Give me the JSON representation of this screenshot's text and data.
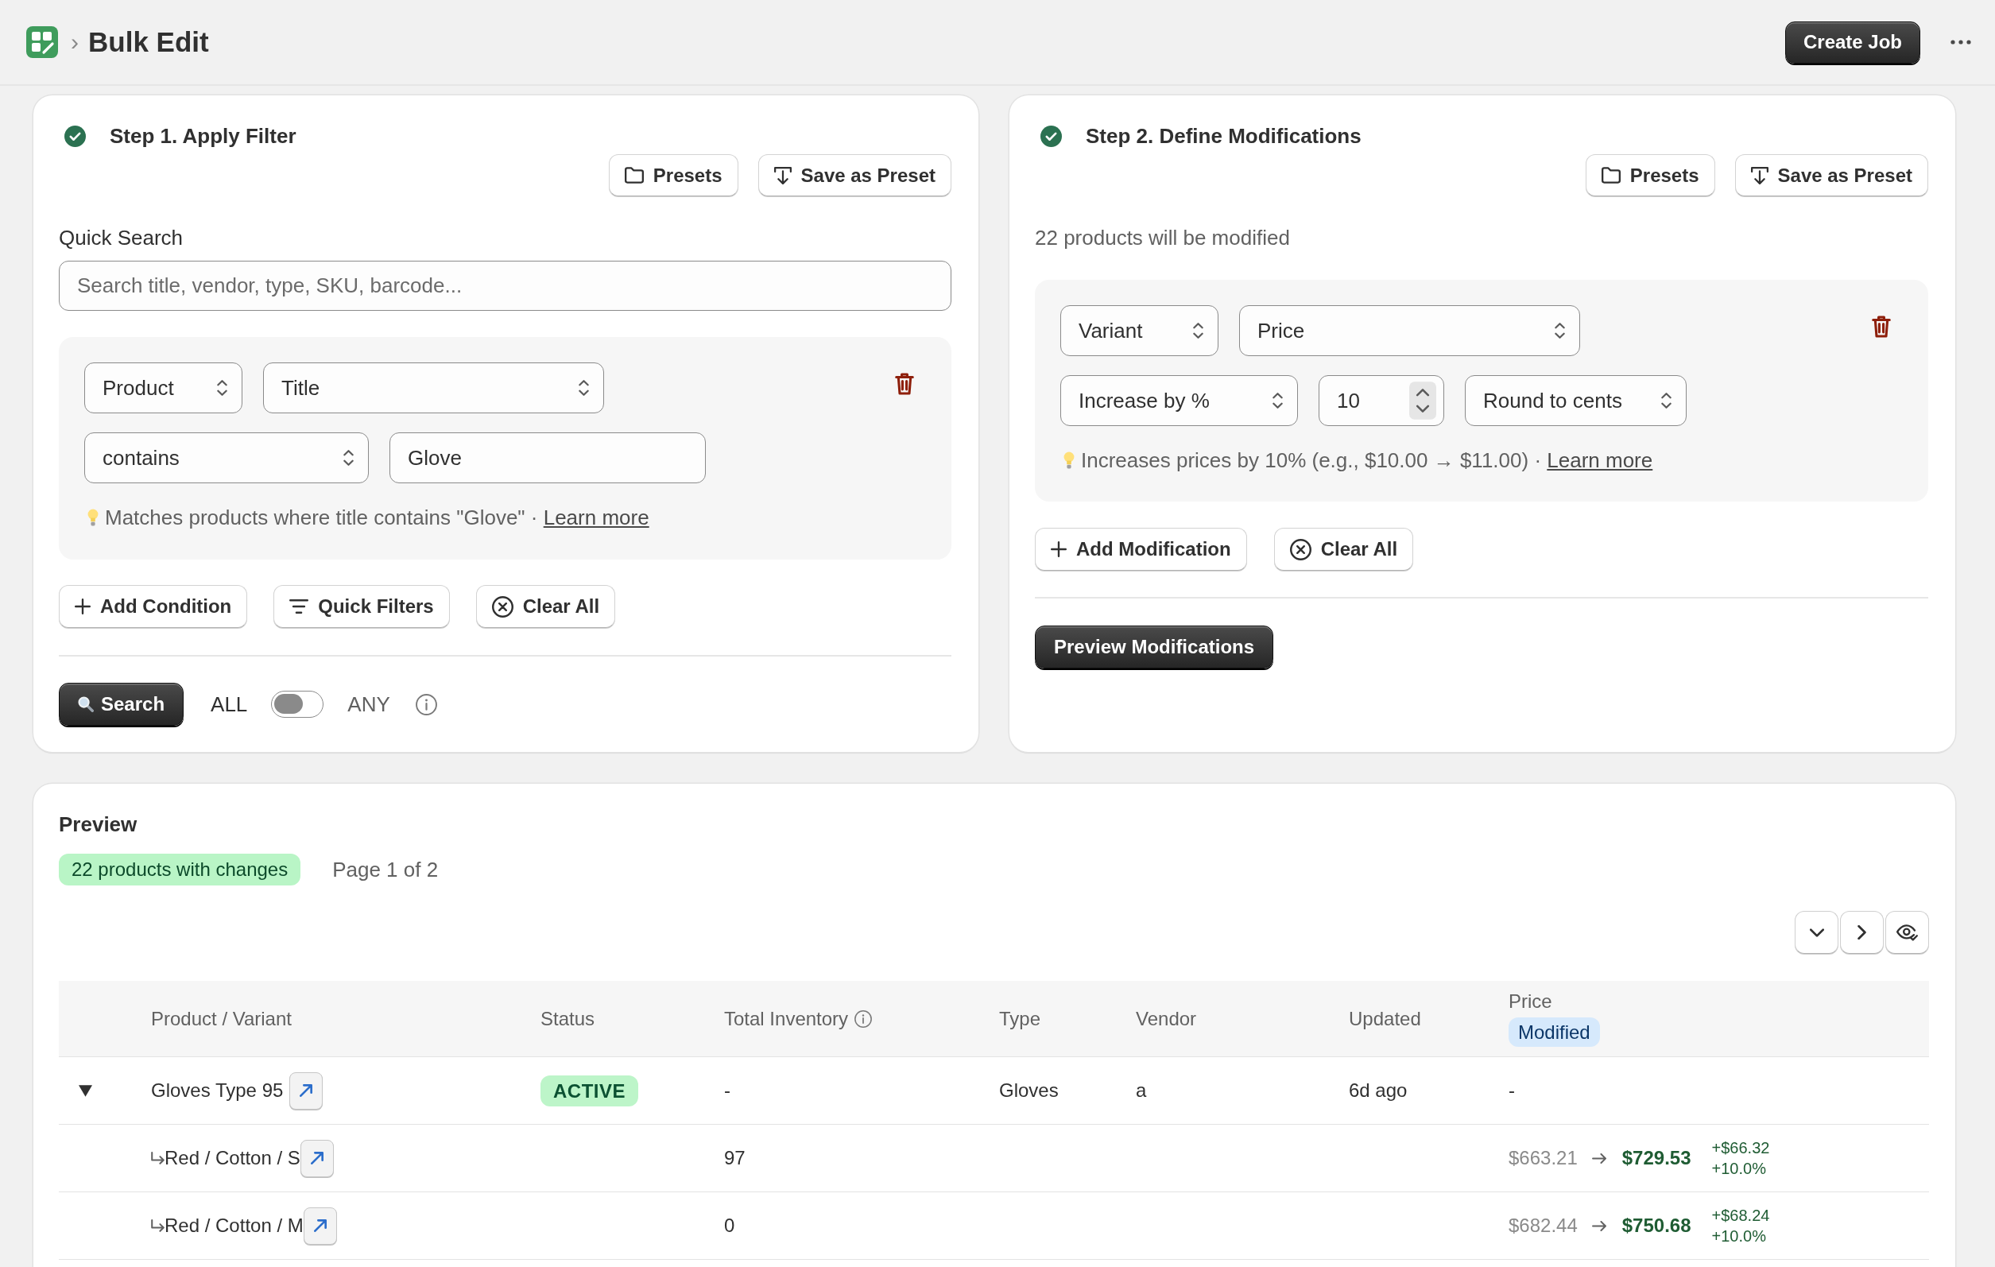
{
  "header": {
    "separator": "›",
    "title": "Bulk Edit",
    "create_job_button": "Create Job"
  },
  "filter_card": {
    "step_title": "Step 1. Apply Filter",
    "completed": true,
    "presets_button": "Presets",
    "save_preset_button": "Save as Preset",
    "quick_search": {
      "label": "Quick Search",
      "placeholder": "Search title, vendor, type, SKU, barcode..."
    },
    "conditions": [
      {
        "scope": "Product",
        "field": "Title",
        "operator": "contains",
        "value": "Glove",
        "hint": "Matches products where title contains \"Glove\" ·",
        "link": "Learn more"
      }
    ],
    "add_condition_button": "Add Condition",
    "quick_filters_button": "Quick Filters",
    "clear_all_button": "Clear All",
    "search_button": "Search",
    "match": {
      "all_label": "ALL",
      "any_label": "ANY",
      "any": false
    }
  },
  "modification_card": {
    "step_title": "Step 2. Define Modifications",
    "completed": true,
    "presets_button": "Presets",
    "save_preset_button": "Save as Preset",
    "summary": "22 products will be modified",
    "modifications": [
      {
        "scope": "Variant",
        "field": "Price",
        "action": "Increase by %",
        "amount": "10",
        "rounding": "Round to cents",
        "hint": "Increases prices by 10% (e.g., $10.00 → $11.00) ·",
        "link": "Learn more"
      }
    ],
    "add_modification_button": "Add Modification",
    "clear_all_button": "Clear All",
    "preview_button": "Preview Modifications"
  },
  "preview": {
    "title": "Preview",
    "changes_badge": "22 products with changes",
    "page_info": "Page 1 of 2",
    "table": {
      "columns": [
        {
          "label": "Product / Variant",
          "info": false
        },
        {
          "label": "Status",
          "info": false
        },
        {
          "label": "Total Inventory",
          "info": true
        },
        {
          "label": "Type",
          "info": false
        },
        {
          "label": "Vendor",
          "info": false
        },
        {
          "label": "Updated",
          "info": false
        },
        {
          "label": "Price",
          "info": false,
          "badge": "Modified"
        }
      ],
      "rows": [
        {
          "product": "Gloves Type 95",
          "expanded": true,
          "status": "ACTIVE",
          "total_inventory": "-",
          "type": "Gloves",
          "vendor": "a",
          "updated": "6d ago",
          "price": "-",
          "children": [
            {
              "variant": "Red / Cotton / S",
              "total_inventory": "97",
              "price_old": "$663.21",
              "price_new": "$729.53",
              "change_amount": "+$66.32",
              "change_percent": "+10.0%"
            },
            {
              "variant": "Red / Cotton / M",
              "total_inventory": "0",
              "price_old": "$682.44",
              "price_new": "$750.68",
              "change_amount": "+$68.24",
              "change_percent": "+10.0%"
            }
          ]
        }
      ]
    }
  }
}
